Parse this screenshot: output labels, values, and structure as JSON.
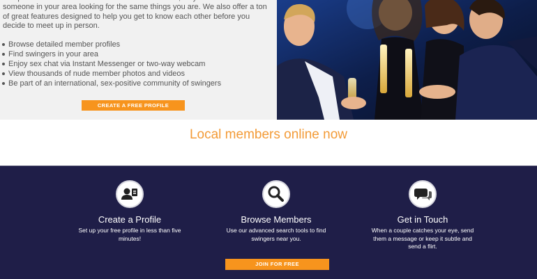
{
  "intro": {
    "text": "Swapfinder.com has millions of members worldwide, so you're sure to find someone in your area looking for the same things you are. We also offer a ton of great features designed to help you get to know each other before you decide to meet up in person.",
    "features": [
      "Browse detailed member profiles",
      "Find swingers in your area",
      "Enjoy sex chat via Instant Messenger or two-way webcam",
      "View thousands of nude member photos and videos",
      "Be part of an international, sex-positive community of swingers"
    ],
    "cta_label": "CREATE A FREE PROFILE"
  },
  "online": {
    "title": "Local members online now"
  },
  "steps": [
    {
      "icon": "profile-card-icon",
      "title": "Create a Profile",
      "desc": "Set up your free profile in less than five minutes!"
    },
    {
      "icon": "magnifier-icon",
      "title": "Browse Members",
      "desc": "Use our advanced search tools to find swingers near you."
    },
    {
      "icon": "chat-bubbles-icon",
      "title": "Get in Touch",
      "desc": "When a couple catches your eye, send them a message or keep it subtle and send a flirt."
    }
  ],
  "join_label": "JOIN FOR FREE",
  "colors": {
    "accent": "#f7941d",
    "title_orange": "#f39b37",
    "navy": "#1f1e48",
    "panel_gray": "#f1f1f1"
  }
}
